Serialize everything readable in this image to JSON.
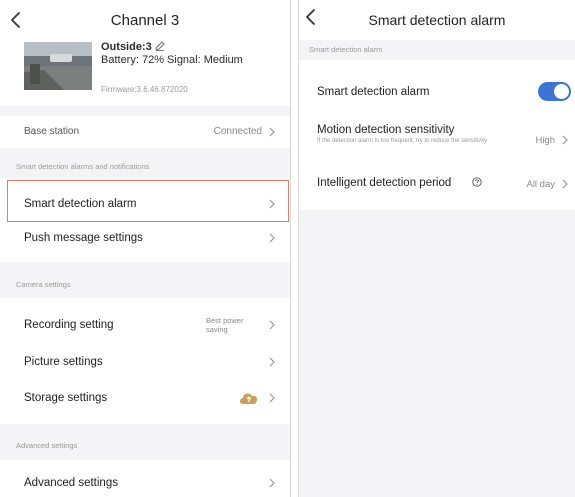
{
  "left": {
    "title": "Channel 3",
    "device": {
      "name": "Outside:3",
      "battery_signal": "Battery: 72% Signal: Medium",
      "firmware": "Firmware:3.6.46.872020"
    },
    "base_station": {
      "label": "Base station",
      "value": "Connected"
    },
    "sections": {
      "alarms": "Smart detection alarms and notifications",
      "camera": "Camera settings",
      "advanced": "Advanced settings"
    },
    "items": {
      "smart_alarm": "Smart detection alarm",
      "push": "Push message settings",
      "recording": "Recording setting",
      "recording_value_line1": "Best power",
      "recording_value_line2": "saving",
      "picture": "Picture settings",
      "storage": "Storage settings",
      "advanced": "Advanced settings"
    }
  },
  "right": {
    "title": "Smart detection alarm",
    "section": "Smart detection alarm",
    "toggle": {
      "label": "Smart detection alarm",
      "on": true
    },
    "sensitivity": {
      "label": "Motion detection sensitivity",
      "hint": "If the detection alarm is too frequent, try to reduce the sensitivity",
      "value": "High"
    },
    "period": {
      "label": "Intelligent detection period",
      "value": "All day"
    }
  },
  "colors": {
    "accent": "#3b74d3",
    "highlight_border": "#e27c6a",
    "cloud": "#c8a15a"
  }
}
